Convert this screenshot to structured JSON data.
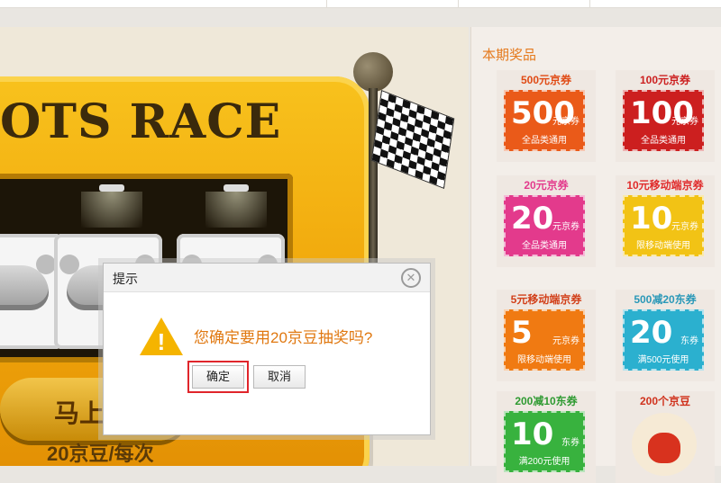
{
  "stage": {
    "machine_title": "OTS RACE",
    "go_button": "马上",
    "cost_label": "20京豆/每次"
  },
  "panel": {
    "heading": "本期奖品",
    "prizes": [
      {
        "title": "500元京券",
        "big": "500",
        "unit": "元京券",
        "sub": "全品类通用",
        "color": "#ea5a19",
        "title_color": "#e04a14"
      },
      {
        "title": "100元京券",
        "big": "100",
        "unit": "元京券",
        "sub": "全品类通用",
        "color": "#cc1f1f",
        "title_color": "#cc1f1f"
      },
      {
        "title": "20元京券",
        "big": "20",
        "unit": "元京券",
        "sub": "全品类通用",
        "color": "#e33a8c",
        "title_color": "#e33a8c"
      },
      {
        "title": "10元移动端京券",
        "big": "10",
        "unit": "元京券",
        "sub": "限移动端使用",
        "color": "#f2c315",
        "title_color": "#e02b2b"
      },
      {
        "title": "5元移动端京券",
        "big": "5",
        "unit": "元京券",
        "sub": "限移动端使用",
        "color": "#f07a12",
        "title_color": "#d2401a"
      },
      {
        "title": "500减20东券",
        "big": "20",
        "unit": "东券",
        "sub": "满500元使用",
        "color": "#2bb0cf",
        "title_color": "#2a98b8"
      },
      {
        "title": "200减10东券",
        "big": "10",
        "unit": "东券",
        "sub": "满200元使用",
        "color": "#38b23e",
        "title_color": "#2e9a31"
      },
      {
        "title": "200个京豆",
        "big": "",
        "unit": "",
        "sub": "",
        "color": "#f6ead5",
        "title_color": "#d0321d"
      }
    ]
  },
  "dialog": {
    "title": "提示",
    "message": "您确定要用20京豆抽奖吗?",
    "ok": "确定",
    "cancel": "取消",
    "close_icon": "close-icon",
    "warning_icon": "warning-icon"
  }
}
